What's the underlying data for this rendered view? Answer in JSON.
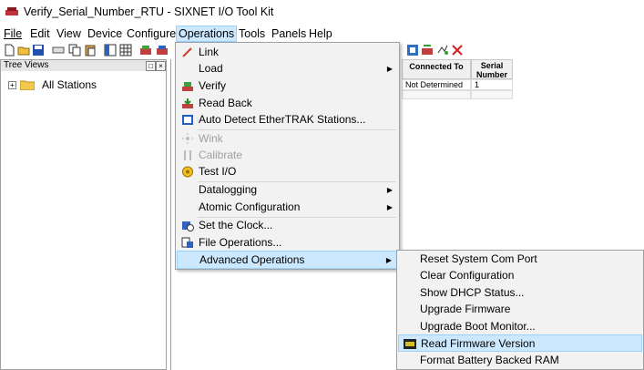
{
  "window": {
    "title": "Verify_Serial_Number_RTU - SIXNET I/O Tool Kit",
    "app_icon": "sixnet-app-icon"
  },
  "menubar": {
    "items": [
      {
        "label": "File",
        "mnemonic_index": 0
      },
      {
        "label": "Edit",
        "mnemonic_index": 0
      },
      {
        "label": "View",
        "mnemonic_index": 0
      },
      {
        "label": "Device",
        "mnemonic_index": 0
      },
      {
        "label": "Configure",
        "mnemonic_index": 0
      },
      {
        "label": "Operations",
        "mnemonic_index": 0,
        "active": true
      },
      {
        "label": "Tools",
        "mnemonic_index": 0
      },
      {
        "label": "Panels",
        "mnemonic_index": 0
      },
      {
        "label": "Help",
        "mnemonic_index": 0
      }
    ]
  },
  "toolbar": {
    "icons": [
      "new-icon",
      "open-icon",
      "save-icon",
      "stations-icon",
      "copy-icon",
      "paste-icon",
      "layout-icon",
      "grid-icon",
      "station-icon",
      "module-icon",
      "tool-icon",
      "connect-icon",
      "disconnect-icon"
    ]
  },
  "tree": {
    "header": "Tree Views",
    "pin_button": "□",
    "close_button": "×",
    "root_label": "All Stations",
    "expander": "+"
  },
  "table": {
    "headers": [
      "Connected To",
      "Serial Number"
    ],
    "rows": [
      [
        "Not Determined",
        "1"
      ]
    ]
  },
  "operations_menu": {
    "items": [
      {
        "label": "Link",
        "underline": "L",
        "icon": "link-icon"
      },
      {
        "label": "Load",
        "underline": "L",
        "icon": "",
        "submenu": true
      },
      {
        "label": "Verify",
        "underline": "V",
        "icon": "verify-icon"
      },
      {
        "label": "Read Back",
        "underline": "R",
        "icon": "read-back-icon"
      },
      {
        "label": "Auto Detect EtherTRAK Stations...",
        "underline": "A",
        "icon": "auto-detect-icon"
      },
      {
        "label": "Wink",
        "underline": "W",
        "icon": "wink-icon",
        "disabled": true
      },
      {
        "label": "Calibrate",
        "underline": "C",
        "icon": "calibrate-icon",
        "disabled": true
      },
      {
        "label": "Test I/O",
        "underline": "T",
        "icon": "test-io-icon"
      },
      {
        "label": "Datalogging",
        "icon": "",
        "submenu": true
      },
      {
        "label": "Atomic Configuration",
        "icon": "",
        "submenu": true
      },
      {
        "label": "Set the Clock...",
        "underline": "S",
        "icon": "clock-icon"
      },
      {
        "label": "File Operations...",
        "underline": "F",
        "icon": "file-operations-icon"
      },
      {
        "label": "Advanced Operations",
        "icon": "",
        "submenu": true,
        "highlighted": true
      }
    ]
  },
  "advanced_submenu": {
    "items": [
      {
        "label": "Reset System Com Port",
        "underline": "R"
      },
      {
        "label": "Clear Configuration",
        "underline": "C"
      },
      {
        "label": "Show DHCP Status...",
        "underline": "D"
      },
      {
        "label": "Upgrade Firmware",
        "underline": "U"
      },
      {
        "label": "Upgrade Boot Monitor...",
        "underline": "B"
      },
      {
        "label": "Read Firmware Version",
        "icon": "firmware-version-icon",
        "highlighted": true
      },
      {
        "label": "Format Battery Backed RAM",
        "underline": "F"
      }
    ]
  },
  "colors": {
    "highlight_bg": "#cce8ff",
    "highlight_border": "#99d1ff",
    "menu_bg": "#f2f2f2",
    "disabled_text": "#a0a0a0"
  }
}
